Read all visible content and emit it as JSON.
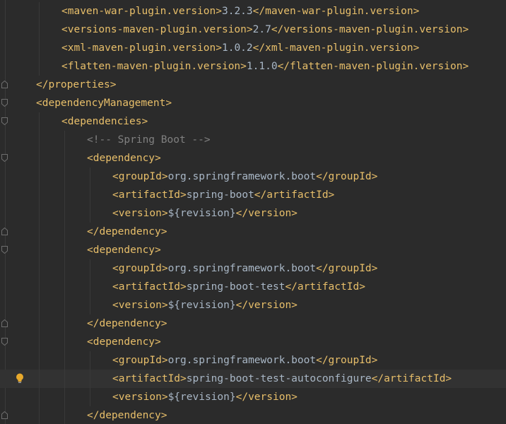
{
  "editor": {
    "lines": [
      {
        "indent": 2,
        "segments": [
          {
            "t": "<maven-war-plugin.version>",
            "c": "tag"
          },
          {
            "t": "3.2.3",
            "c": "text"
          },
          {
            "t": "</maven-war-plugin.version>",
            "c": "tag"
          }
        ]
      },
      {
        "indent": 2,
        "segments": [
          {
            "t": "<versions-maven-plugin.version>",
            "c": "tag"
          },
          {
            "t": "2.7",
            "c": "text"
          },
          {
            "t": "</versions-maven-plugin.version>",
            "c": "tag"
          }
        ]
      },
      {
        "indent": 2,
        "segments": [
          {
            "t": "<xml-maven-plugin.version>",
            "c": "tag"
          },
          {
            "t": "1.0.2",
            "c": "text"
          },
          {
            "t": "</xml-maven-plugin.version>",
            "c": "tag"
          }
        ]
      },
      {
        "indent": 2,
        "segments": [
          {
            "t": "<flatten-maven-plugin.version>",
            "c": "tag"
          },
          {
            "t": "1.1.0",
            "c": "text"
          },
          {
            "t": "</flatten-maven-plugin.version>",
            "c": "tag"
          }
        ]
      },
      {
        "indent": 1,
        "fold": "end",
        "segments": [
          {
            "t": "</properties>",
            "c": "tag"
          }
        ]
      },
      {
        "indent": 1,
        "fold": "start",
        "segments": [
          {
            "t": "<dependencyManagement>",
            "c": "tag"
          }
        ]
      },
      {
        "indent": 2,
        "fold": "start",
        "segments": [
          {
            "t": "<dependencies>",
            "c": "tag"
          }
        ]
      },
      {
        "indent": 3,
        "segments": [
          {
            "t": "<!-- Spring Boot -->",
            "c": "comment"
          }
        ]
      },
      {
        "indent": 3,
        "fold": "start",
        "segments": [
          {
            "t": "<dependency>",
            "c": "tag"
          }
        ]
      },
      {
        "indent": 4,
        "segments": [
          {
            "t": "<groupId>",
            "c": "tag"
          },
          {
            "t": "org.springframework.boot",
            "c": "text"
          },
          {
            "t": "</groupId>",
            "c": "tag"
          }
        ]
      },
      {
        "indent": 4,
        "segments": [
          {
            "t": "<artifactId>",
            "c": "tag"
          },
          {
            "t": "spring-boot",
            "c": "text"
          },
          {
            "t": "</artifactId>",
            "c": "tag"
          }
        ]
      },
      {
        "indent": 4,
        "segments": [
          {
            "t": "<version>",
            "c": "tag"
          },
          {
            "t": "${revision}",
            "c": "text"
          },
          {
            "t": "</version>",
            "c": "tag"
          }
        ]
      },
      {
        "indent": 3,
        "fold": "end",
        "segments": [
          {
            "t": "</dependency>",
            "c": "tag"
          }
        ]
      },
      {
        "indent": 3,
        "fold": "start",
        "segments": [
          {
            "t": "<dependency>",
            "c": "tag"
          }
        ]
      },
      {
        "indent": 4,
        "segments": [
          {
            "t": "<groupId>",
            "c": "tag"
          },
          {
            "t": "org.springframework.boot",
            "c": "text"
          },
          {
            "t": "</groupId>",
            "c": "tag"
          }
        ]
      },
      {
        "indent": 4,
        "segments": [
          {
            "t": "<artifactId>",
            "c": "tag"
          },
          {
            "t": "spring-boot-test",
            "c": "text"
          },
          {
            "t": "</artifactId>",
            "c": "tag"
          }
        ]
      },
      {
        "indent": 4,
        "segments": [
          {
            "t": "<version>",
            "c": "tag"
          },
          {
            "t": "${revision}",
            "c": "text"
          },
          {
            "t": "</version>",
            "c": "tag"
          }
        ]
      },
      {
        "indent": 3,
        "fold": "end",
        "segments": [
          {
            "t": "</dependency>",
            "c": "tag"
          }
        ]
      },
      {
        "indent": 3,
        "fold": "start",
        "segments": [
          {
            "t": "<dependency>",
            "c": "tag"
          }
        ]
      },
      {
        "indent": 4,
        "segments": [
          {
            "t": "<groupId>",
            "c": "tag"
          },
          {
            "t": "org.springframework.boot",
            "c": "text"
          },
          {
            "t": "</groupId>",
            "c": "tag"
          }
        ]
      },
      {
        "indent": 4,
        "current": true,
        "bulb": true,
        "segments": [
          {
            "t": "<artifactId>",
            "c": "tag"
          },
          {
            "t": "spring-boot-test-autoconfigure",
            "c": "text"
          },
          {
            "t": "</artifactId>",
            "c": "tag"
          }
        ]
      },
      {
        "indent": 4,
        "segments": [
          {
            "t": "<version>",
            "c": "tag"
          },
          {
            "t": "${revision}",
            "c": "text"
          },
          {
            "t": "</version>",
            "c": "tag"
          }
        ]
      },
      {
        "indent": 3,
        "fold": "end",
        "segments": [
          {
            "t": "</dependency>",
            "c": "tag"
          }
        ]
      }
    ]
  },
  "colors": {
    "background": "#2b2b2b",
    "current_line": "#323232",
    "tag": "#e8bf6a",
    "text": "#a9b7c6",
    "comment": "#808080",
    "bulb": "#e8a92c"
  },
  "icons": {
    "fold_start": "fold-start-icon",
    "fold_end": "fold-end-icon",
    "intention": "lightbulb-icon"
  }
}
